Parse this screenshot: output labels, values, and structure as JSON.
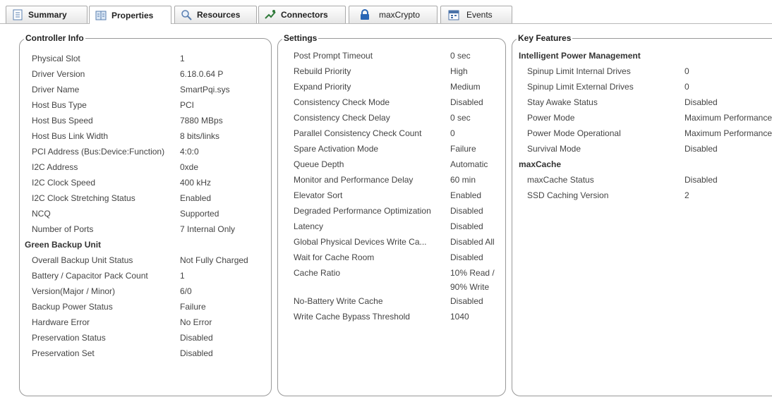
{
  "tabs": [
    {
      "label": "Summary",
      "icon": "summary-icon"
    },
    {
      "label": "Properties",
      "icon": "properties-icon"
    },
    {
      "label": "Resources",
      "icon": "magnifier-icon"
    },
    {
      "label": "Connectors",
      "icon": "connector-icon"
    },
    {
      "label": "maxCrypto",
      "icon": "lock-icon"
    },
    {
      "label": "Events",
      "icon": "calendar-icon"
    }
  ],
  "controller": {
    "title": "Controller Info",
    "rows": [
      [
        "Physical Slot",
        "1"
      ],
      [
        "Driver Version",
        "6.18.0.64 P"
      ],
      [
        "Driver Name",
        "SmartPqi.sys"
      ],
      [
        "Host Bus Type",
        "PCI"
      ],
      [
        "Host Bus Speed",
        "7880 MBps"
      ],
      [
        "Host Bus Link Width",
        "8 bits/links"
      ],
      [
        "PCI Address (Bus:Device:Function)",
        "4:0:0"
      ],
      [
        "I2C Address",
        "0xde"
      ],
      [
        "I2C Clock Speed",
        "400 kHz"
      ],
      [
        "I2C Clock Stretching Status",
        "Enabled"
      ],
      [
        "NCQ",
        "Supported"
      ],
      [
        "Number of Ports",
        "7 Internal Only"
      ]
    ],
    "gbu_title": "Green Backup Unit",
    "gbu_rows": [
      [
        "Overall Backup Unit Status",
        "Not Fully Charged"
      ],
      [
        "Battery / Capacitor Pack Count",
        "1"
      ],
      [
        "Version(Major / Minor)",
        "6/0"
      ],
      [
        "Backup Power Status",
        "Failure"
      ],
      [
        "Hardware Error",
        "No Error"
      ],
      [
        "Preservation Status",
        "Disabled"
      ],
      [
        "Preservation Set",
        "Disabled"
      ]
    ]
  },
  "settings": {
    "title": "Settings",
    "rows": [
      [
        "Post Prompt Timeout",
        "0 sec"
      ],
      [
        "Rebuild Priority",
        "High"
      ],
      [
        "Expand Priority",
        "Medium"
      ],
      [
        "Consistency Check Mode",
        "Disabled"
      ],
      [
        "Consistency Check Delay",
        "0 sec"
      ],
      [
        "Parallel Consistency Check Count",
        "0"
      ],
      [
        "Spare Activation Mode",
        "Failure"
      ],
      [
        "Queue Depth",
        "Automatic"
      ],
      [
        "Monitor and Performance Delay",
        "60 min"
      ],
      [
        "Elevator Sort",
        "Enabled"
      ],
      [
        "Degraded Performance Optimization",
        "Disabled"
      ],
      [
        "Latency",
        "Disabled"
      ],
      [
        "Global Physical Devices Write Ca...",
        "Disabled All"
      ],
      [
        "Wait for Cache Room",
        "Disabled"
      ],
      [
        "Cache Ratio",
        "10% Read /"
      ],
      [
        "",
        "90% Write"
      ],
      [
        "No-Battery Write Cache",
        "Disabled"
      ],
      [
        "Write Cache Bypass Threshold",
        "1040"
      ]
    ]
  },
  "features": {
    "title": "Key Features",
    "ipm_title": "Intelligent Power Management",
    "ipm_rows": [
      [
        "Spinup Limit Internal Drives",
        "0"
      ],
      [
        "Spinup Limit External Drives",
        "0"
      ],
      [
        "Stay Awake Status",
        "Disabled"
      ],
      [
        "Power Mode",
        "Maximum Performance"
      ],
      [
        "Power Mode Operational",
        "Maximum Performance"
      ],
      [
        "Survival Mode",
        "Disabled"
      ]
    ],
    "maxcache_title": "maxCache",
    "maxcache_rows": [
      [
        "maxCache Status",
        "Disabled"
      ],
      [
        "SSD Caching Version",
        "2"
      ]
    ]
  }
}
